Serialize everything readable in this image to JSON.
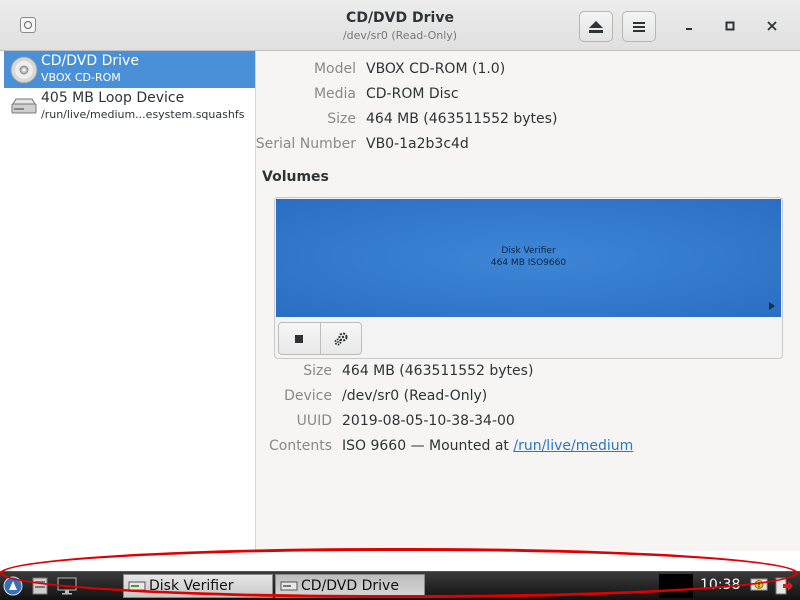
{
  "header": {
    "title": "CD/DVD Drive",
    "subtitle": "/dev/sr0 (Read-Only)",
    "eject_icon": "eject-icon",
    "menu_icon": "hamburger-menu-icon",
    "window_controls": [
      "minimize",
      "maximize",
      "close"
    ]
  },
  "sidebar": {
    "items": [
      {
        "name": "CD/DVD Drive",
        "sub": "VBOX CD-ROM",
        "icon": "optical-disc-icon",
        "selected": true
      },
      {
        "name": "405 MB Loop Device",
        "sub": "/run/live/medium...esystem.squashfs",
        "icon": "hard-disk-icon",
        "selected": false
      }
    ]
  },
  "drive": {
    "model_label": "Model",
    "model": "VBOX CD-ROM (1.0)",
    "media_label": "Media",
    "media": "CD-ROM Disc",
    "size_label": "Size",
    "size": "464 MB (463511552 bytes)",
    "serial_label": "Serial Number",
    "serial": "VB0-1a2b3c4d"
  },
  "volumes": {
    "title": "Volumes",
    "partition_name": "Disk Verifier",
    "partition_size": "464 MB ISO9660",
    "tools": [
      "stop-icon",
      "gears-icon"
    ],
    "size_label": "Size",
    "size": "464 MB (463511552 bytes)",
    "device_label": "Device",
    "device": "/dev/sr0 (Read-Only)",
    "uuid_label": "UUID",
    "uuid": "2019-08-05-10-38-34-00",
    "contents_label": "Contents",
    "contents_prefix": "ISO 9660 — Mounted at ",
    "contents_link": "/run/live/medium"
  },
  "taskbar": {
    "tasks": [
      {
        "label": "Disk Verifier",
        "active": false
      },
      {
        "label": "CD/DVD Drive",
        "active": true
      }
    ],
    "clock": "10:38"
  }
}
